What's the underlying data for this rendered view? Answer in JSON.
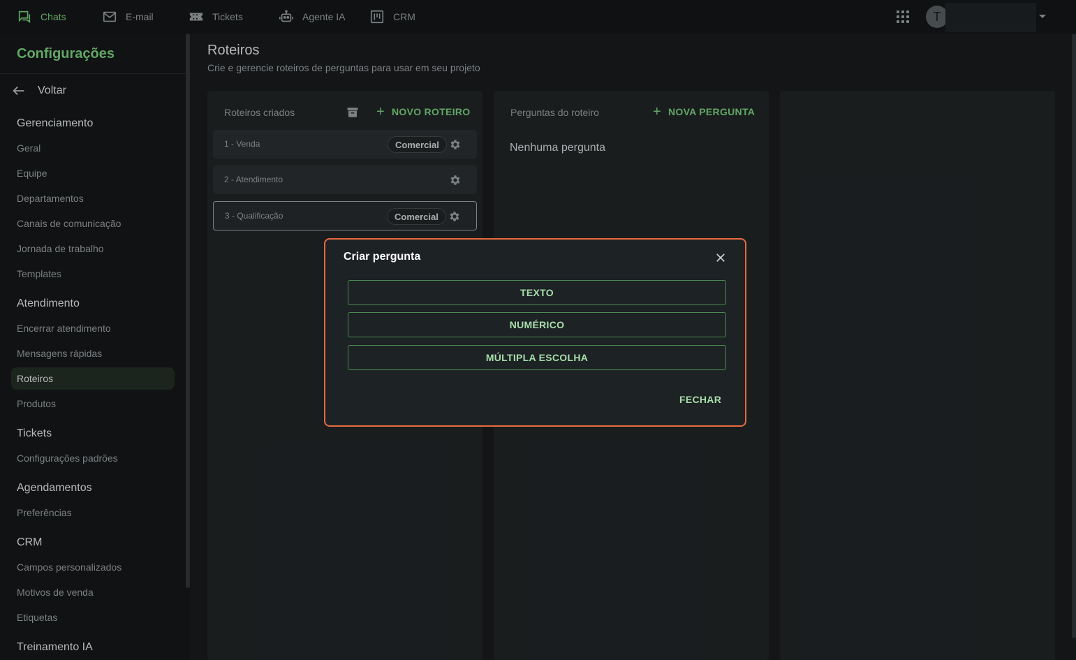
{
  "topnav": {
    "items": [
      {
        "label": "Chats",
        "icon": "chat-icon",
        "active": true
      },
      {
        "label": "E-mail",
        "icon": "mail-icon"
      },
      {
        "label": "Tickets",
        "icon": "ticket-icon"
      },
      {
        "label": "Agente IA",
        "icon": "robot-icon"
      },
      {
        "label": "CRM",
        "icon": "kanban-icon"
      }
    ],
    "avatar_initial": "T"
  },
  "sidebar": {
    "title": "Configurações",
    "back_label": "Voltar",
    "sections": [
      {
        "title": "Gerenciamento",
        "items": [
          "Geral",
          "Equipe",
          "Departamentos",
          "Canais de comunicação",
          "Jornada de trabalho",
          "Templates"
        ]
      },
      {
        "title": "Atendimento",
        "items": [
          "Encerrar atendimento",
          "Mensagens rápidas",
          "Roteiros",
          "Produtos"
        ]
      },
      {
        "title": "Tickets",
        "items": [
          "Configurações padrões"
        ]
      },
      {
        "title": "Agendamentos",
        "items": [
          "Preferências"
        ]
      },
      {
        "title": "CRM",
        "items": [
          "Campos personalizados",
          "Motivos de venda",
          "Etiquetas"
        ]
      },
      {
        "title": "Treinamento IA",
        "items": []
      }
    ],
    "active_item": "Roteiros"
  },
  "page": {
    "title": "Roteiros",
    "subtitle": "Crie e gerencie roteiros de perguntas para usar em seu projeto"
  },
  "scripts_panel": {
    "label": "Roteiros criados",
    "new_label": "NOVO ROTEIRO",
    "rows": [
      {
        "name": "1 - Venda",
        "tag": "Comercial"
      },
      {
        "name": "2 - Atendimento",
        "tag": ""
      },
      {
        "name": "3 - Qualificação",
        "tag": "Comercial"
      }
    ]
  },
  "questions_panel": {
    "label": "Perguntas do roteiro",
    "new_label": "NOVA PERGUNTA",
    "empty_text": "Nenhuma pergunta"
  },
  "modal": {
    "title": "Criar pergunta",
    "options": [
      "TEXTO",
      "NUMÉRICO",
      "MÚLTIPLA ESCOLHA"
    ],
    "close_label": "FECHAR"
  },
  "colors": {
    "accent": "#6fbf73",
    "modal_border": "#e8693f"
  }
}
